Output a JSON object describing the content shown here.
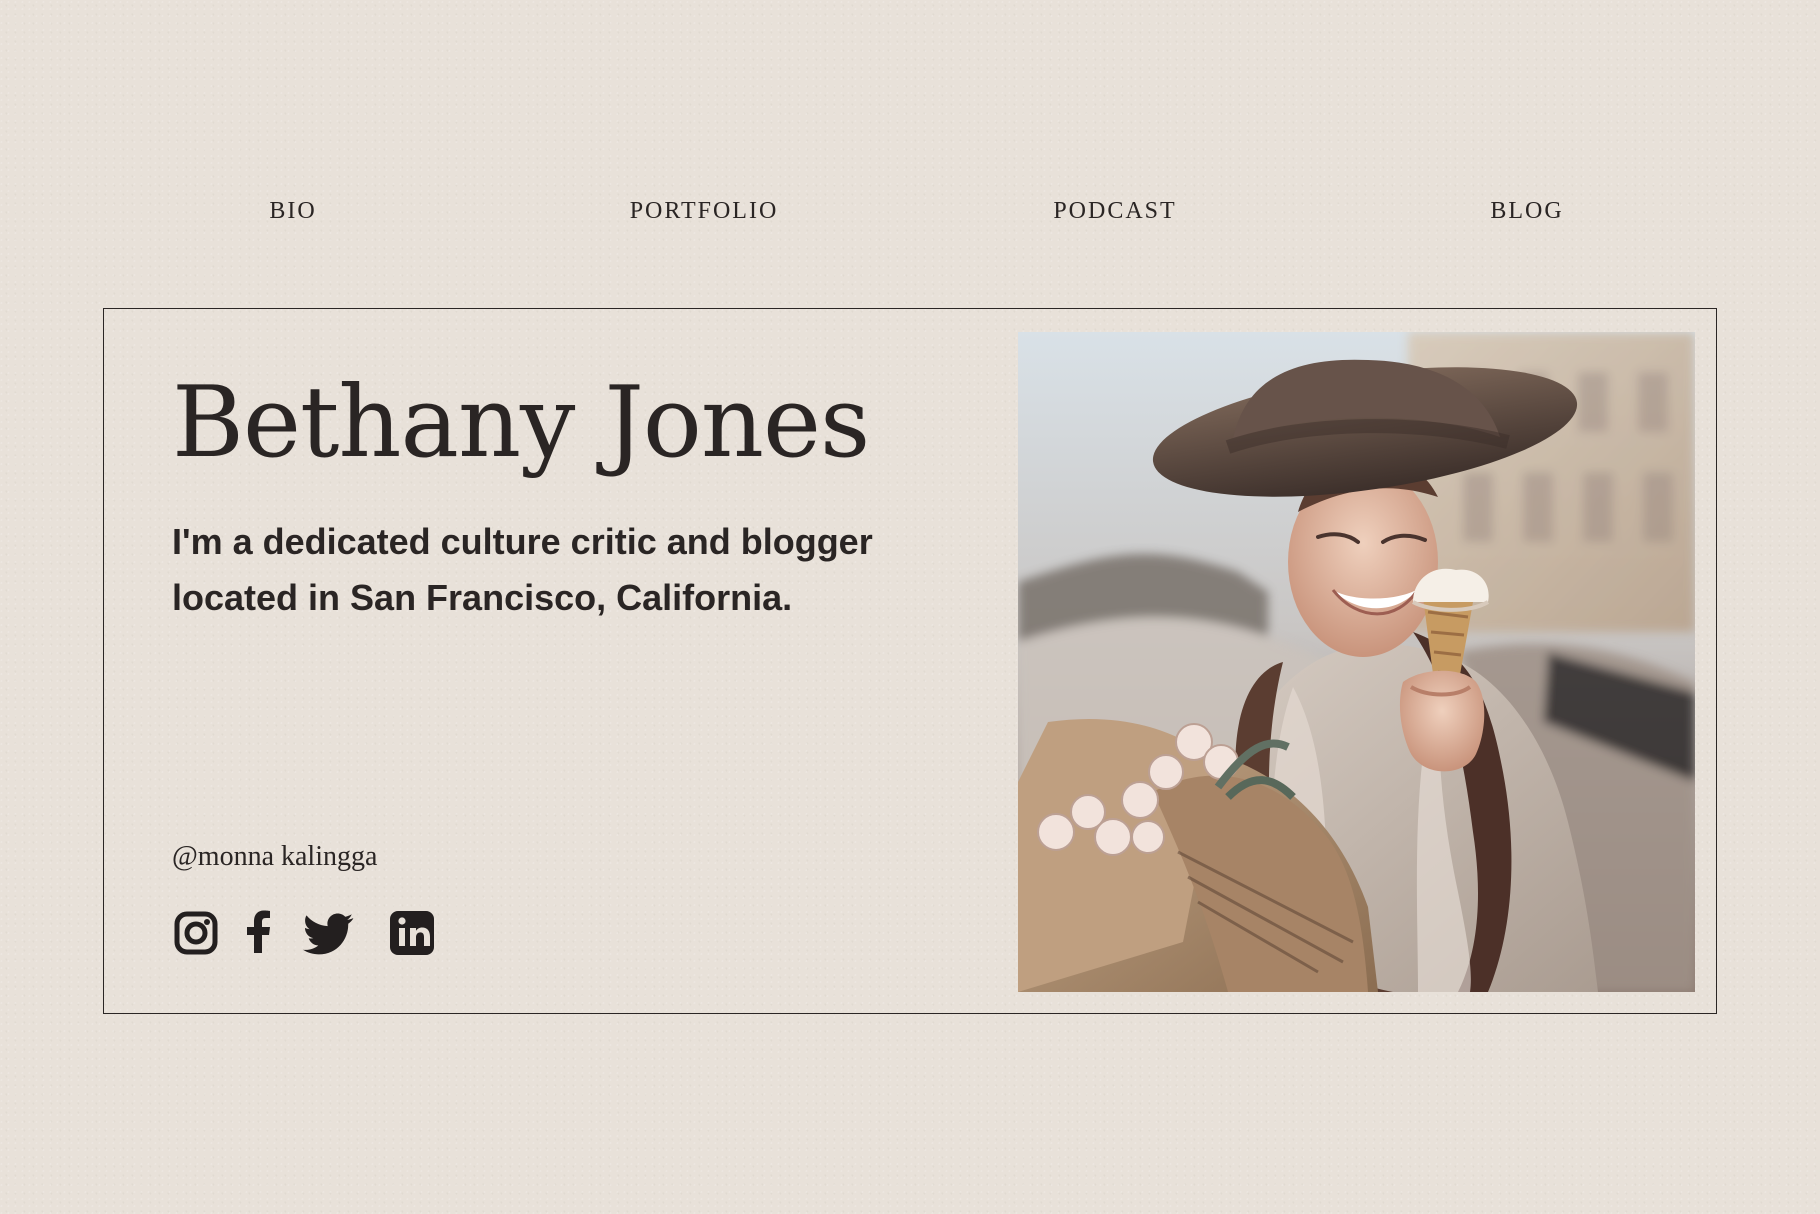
{
  "nav": {
    "items": [
      {
        "label": "BIO"
      },
      {
        "label": "PORTFOLIO"
      },
      {
        "label": "PODCAST"
      },
      {
        "label": "BLOG"
      }
    ]
  },
  "profile": {
    "name": "Bethany Jones",
    "bio": "I'm a dedicated culture critic and blogger located in San Francisco, California.",
    "handle": "@monna kalingga"
  },
  "socials": {
    "icons": [
      "instagram-icon",
      "facebook-icon",
      "twitter-icon",
      "linkedin-icon"
    ]
  },
  "colors": {
    "background": "#e8e1d9",
    "text": "#231f1f",
    "border": "#2b2625"
  }
}
